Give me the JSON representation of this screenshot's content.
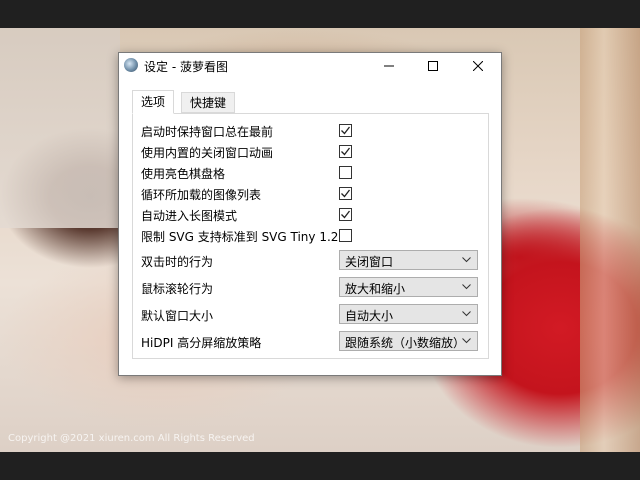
{
  "viewer": {
    "copyright": "Copyright @2021  xiuren.com  All Rights Reserved"
  },
  "dialog": {
    "title": "设定 - 菠萝看图",
    "window_buttons": [
      "minimize-icon",
      "maximize-icon",
      "close-icon"
    ],
    "tabs": [
      {
        "label": "选项",
        "active": true
      },
      {
        "label": "快捷键",
        "active": false
      }
    ],
    "checkboxes": [
      {
        "label": "启动时保持窗口总在最前",
        "checked": true
      },
      {
        "label": "使用内置的关闭窗口动画",
        "checked": true
      },
      {
        "label": "使用亮色棋盘格",
        "checked": false
      },
      {
        "label": "循环所加载的图像列表",
        "checked": true
      },
      {
        "label": "自动进入长图模式",
        "checked": true
      },
      {
        "label": "限制 SVG 支持标准到 SVG Tiny 1.2",
        "checked": false
      }
    ],
    "selects": [
      {
        "label": "双击时的行为",
        "value": "关闭窗口"
      },
      {
        "label": "鼠标滚轮行为",
        "value": "放大和缩小"
      },
      {
        "label": "默认窗口大小",
        "value": "自动大小"
      },
      {
        "label": "HiDPI 高分屏缩放策略",
        "value": "跟随系统（小数缩放）"
      }
    ]
  }
}
